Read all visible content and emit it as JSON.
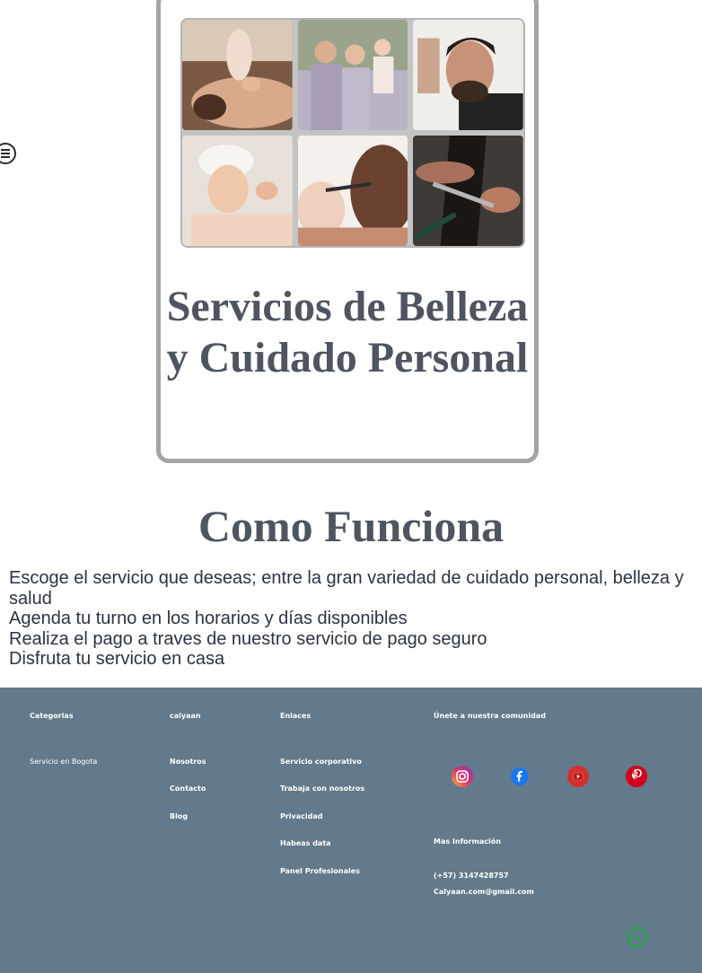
{
  "nav": {
    "menu_icon": "hamburger-menu-icon"
  },
  "hero": {
    "photos": [
      "massage-photo",
      "family-photo",
      "barber-photo",
      "facial-photo",
      "makeup-photo",
      "haircut-photo"
    ],
    "title": "Servicios de Belleza y Cuidado Personal"
  },
  "how_it_works": {
    "title": "Como Funciona",
    "steps": [
      "Escoge el servicio que deseas; entre la gran variedad de cuidado personal, belleza y salud",
      "Agenda tu turno en los horarios y días disponibles",
      "Realiza el pago a traves de nuestro servicio de pago seguro",
      "Disfruta tu servicio en casa"
    ]
  },
  "footer": {
    "col1": {
      "heading": "Categorias",
      "items": [
        "Servicio en Bogota"
      ]
    },
    "col2": {
      "heading": "calyaan",
      "items": [
        "Nosotros",
        "Contacto",
        "Blog"
      ]
    },
    "col3": {
      "heading": "Enlaces",
      "items": [
        "Servicio corporativo",
        "Trabaja con nosotros",
        "Privacidad",
        "Habeas data",
        "Panel Profesionales"
      ]
    },
    "community": {
      "heading": "Únete a nuestra comunidad",
      "social": [
        "instagram-icon",
        "facebook-icon",
        "youtube-icon",
        "pinterest-icon"
      ]
    },
    "info": {
      "heading": "Mas Información",
      "phone": "(+57) 3147428757",
      "email": "Calyaan.com@gmail.com"
    },
    "whatsapp_icon": "whatsapp-icon",
    "colors": {
      "background": "#627a8b",
      "instagram": "#e1306c",
      "facebook": "#1877f2",
      "youtube": "#d32f2f",
      "pinterest": "#d0021b",
      "whatsapp": "#25a244"
    }
  }
}
